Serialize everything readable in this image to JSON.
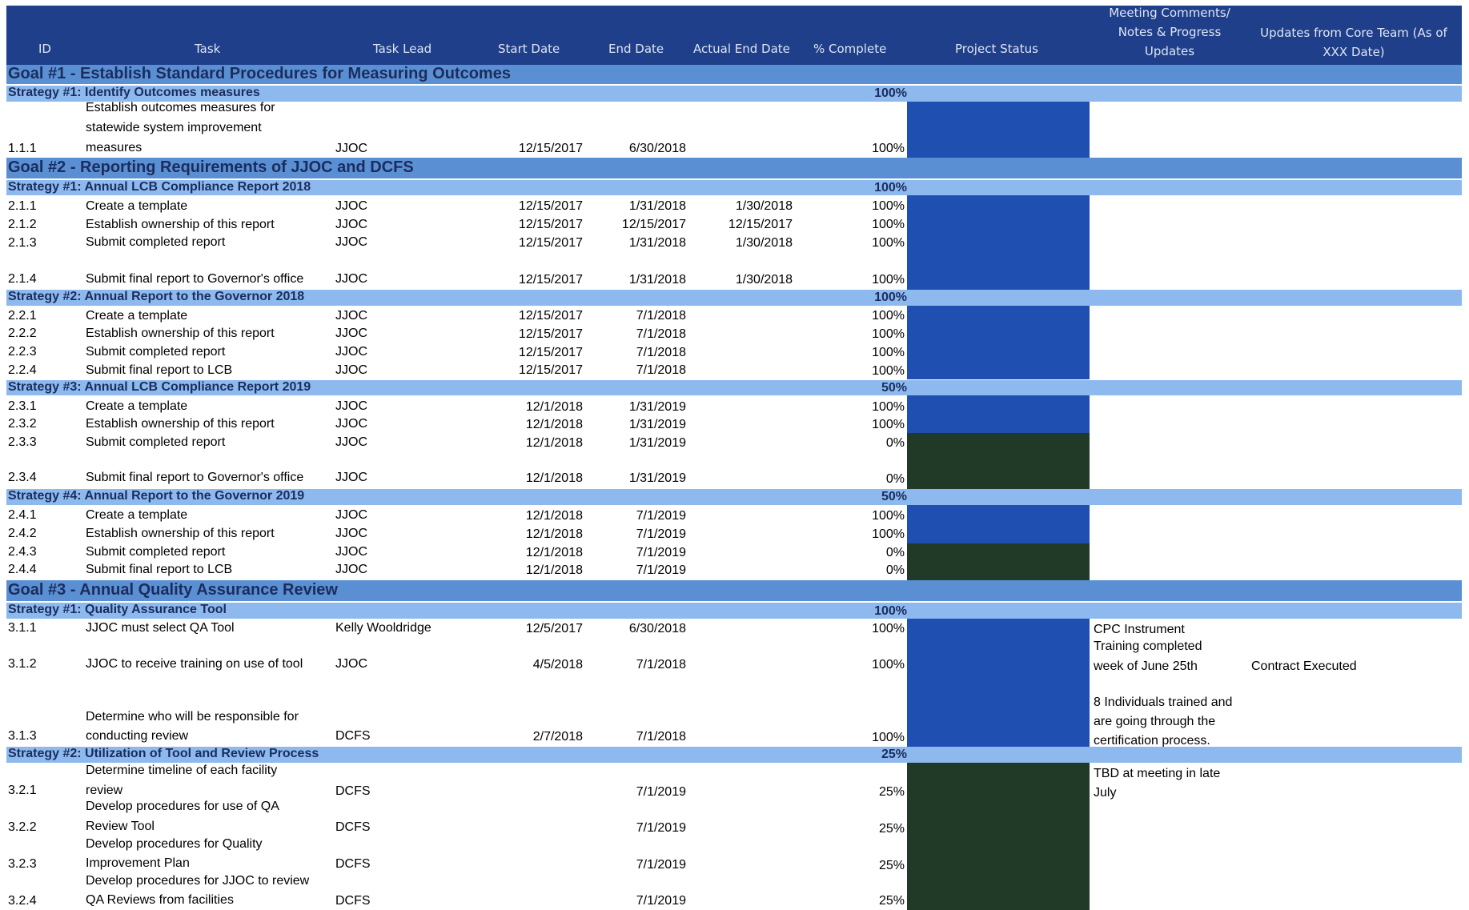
{
  "headers": {
    "id": "ID",
    "task": "Task",
    "lead": "Task Lead",
    "start": "Start Date",
    "end": "End Date",
    "actual_end": "Actual End Date",
    "pct": "% Complete",
    "status": "Project Status",
    "meeting_1": "Meeting Comments/",
    "meeting_2": "Notes & Progress",
    "meeting_3": "Updates",
    "core_1": "Updates from Core Team (As of",
    "core_2": "XXX Date)"
  },
  "colors": {
    "header": "#1f3f8a",
    "goal": "#5b8fd4",
    "strategy": "#8db9ef",
    "status_blue": "#1f4fb0",
    "status_green": "#213a27"
  },
  "goal1": {
    "title": "Goal #1 - Establish Standard Procedures for Measuring Outcomes"
  },
  "g1s1": {
    "title": "Strategy #1: Identify Outcomes measures",
    "pct": "100%"
  },
  "t111": {
    "id": "1.1.1",
    "task_1": "Establish outcomes measures for",
    "task_2": "statewide system improvement",
    "task_3": "measures",
    "lead": "JJOC",
    "start": "12/15/2017",
    "end": "6/30/2018",
    "actual": "",
    "pct": "100%"
  },
  "goal2": {
    "title": "Goal #2 - Reporting Requirements of JJOC and DCFS"
  },
  "g2s1": {
    "title": "Strategy #1: Annual LCB Compliance Report 2018",
    "pct": "100%"
  },
  "t211": {
    "id": "2.1.1",
    "task": "Create a template",
    "lead": "JJOC",
    "start": "12/15/2017",
    "end": "1/31/2018",
    "actual": "1/30/2018",
    "pct": "100%"
  },
  "t212": {
    "id": "2.1.2",
    "task": "Establish ownership of this report",
    "lead": "JJOC",
    "start": "12/15/2017",
    "end": "12/15/2017",
    "actual": "12/15/2017",
    "pct": "100%"
  },
  "t213": {
    "id": "2.1.3",
    "task": "Submit completed report",
    "lead": "JJOC",
    "start": "12/15/2017",
    "end": "1/31/2018",
    "actual": "1/30/2018",
    "pct": "100%"
  },
  "t214": {
    "id": "2.1.4",
    "task": "Submit final report to Governor's office",
    "lead": "JJOC",
    "start": "12/15/2017",
    "end": "1/31/2018",
    "actual": "1/30/2018",
    "pct": "100%"
  },
  "g2s2": {
    "title": "Strategy #2: Annual Report to the Governor 2018",
    "pct": "100%"
  },
  "t221": {
    "id": "2.2.1",
    "task": "Create a template",
    "lead": "JJOC",
    "start": "12/15/2017",
    "end": "7/1/2018",
    "pct": "100%"
  },
  "t222": {
    "id": "2.2.2",
    "task": "Establish ownership of this report",
    "lead": "JJOC",
    "start": "12/15/2017",
    "end": "7/1/2018",
    "pct": "100%"
  },
  "t223": {
    "id": "2.2.3",
    "task": "Submit completed report",
    "lead": "JJOC",
    "start": "12/15/2017",
    "end": "7/1/2018",
    "pct": "100%"
  },
  "t224": {
    "id": "2.2.4",
    "task": "Submit final report to LCB",
    "lead": "JJOC",
    "start": "12/15/2017",
    "end": "7/1/2018",
    "pct": "100%"
  },
  "g2s3": {
    "title": "Strategy #3: Annual LCB Compliance Report 2019",
    "pct": "50%"
  },
  "t231": {
    "id": "2.3.1",
    "task": "Create a template",
    "lead": "JJOC",
    "start": "12/1/2018",
    "end": "1/31/2019",
    "pct": "100%"
  },
  "t232": {
    "id": "2.3.2",
    "task": "Establish ownership of this report",
    "lead": "JJOC",
    "start": "12/1/2018",
    "end": "1/31/2019",
    "pct": "100%"
  },
  "t233": {
    "id": "2.3.3",
    "task": "Submit completed report",
    "lead": "JJOC",
    "start": "12/1/2018",
    "end": "1/31/2019",
    "pct": "0%"
  },
  "t234": {
    "id": "2.3.4",
    "task": "Submit final report to Governor's office",
    "lead": "JJOC",
    "start": "12/1/2018",
    "end": "1/31/2019",
    "pct": "0%"
  },
  "g2s4": {
    "title": "Strategy #4: Annual Report to the Governor 2019",
    "pct": "50%"
  },
  "t241": {
    "id": "2.4.1",
    "task": "Create a template",
    "lead": "JJOC",
    "start": "12/1/2018",
    "end": "7/1/2019",
    "pct": "100%"
  },
  "t242": {
    "id": "2.4.2",
    "task": "Establish ownership of this report",
    "lead": "JJOC",
    "start": "12/1/2018",
    "end": "7/1/2019",
    "pct": "100%"
  },
  "t243": {
    "id": "2.4.3",
    "task": "Submit completed report",
    "lead": "JJOC",
    "start": "12/1/2018",
    "end": "7/1/2019",
    "pct": "0%"
  },
  "t244": {
    "id": "2.4.4",
    "task": "Submit final report to LCB",
    "lead": "JJOC",
    "start": "12/1/2018",
    "end": "7/1/2019",
    "pct": "0%"
  },
  "goal3": {
    "title": "Goal #3 - Annual Quality Assurance Review"
  },
  "g3s1": {
    "title": "Strategy #1: Quality Assurance Tool",
    "pct": "100%"
  },
  "t311": {
    "id": "3.1.1",
    "task": "JJOC must select QA Tool",
    "lead": "Kelly Wooldridge",
    "start": "12/5/2017",
    "end": "6/30/2018",
    "pct": "100%"
  },
  "t312": {
    "id": "3.1.2",
    "task": "JJOC to receive training on use of tool",
    "lead": "JJOC",
    "start": "4/5/2018",
    "end": "7/1/2018",
    "pct": "100%"
  },
  "t313": {
    "id": "3.1.3",
    "task_1": "Determine who will be responsible for",
    "task_2": "conducting review",
    "lead": "DCFS",
    "start": "2/7/2018",
    "end": "7/1/2018",
    "pct": "100%"
  },
  "notes31": {
    "n1": "CPC Instrument",
    "n2": "Training completed",
    "n3": "week of June 25th",
    "core": "Contract Executed",
    "n4": "8 Individuals trained and",
    "n5": "are going through the",
    "n6": "certification process."
  },
  "g3s2": {
    "title": "Strategy #2: Utilization of Tool and Review Process",
    "pct": "25%"
  },
  "t321": {
    "id": "3.2.1",
    "task_1": "Determine timeline of each facility",
    "task_2": "review",
    "lead": "DCFS",
    "end": "7/1/2019",
    "pct": "25%"
  },
  "t322": {
    "id": "3.2.2",
    "task_1": "Develop procedures for use of QA",
    "task_2": "Review Tool",
    "lead": "DCFS",
    "end": "7/1/2019",
    "pct": "25%"
  },
  "t323": {
    "id": "3.2.3",
    "task_1": "Develop procedures for Quality",
    "task_2": "Improvement Plan",
    "lead": "DCFS",
    "end": "7/1/2019",
    "pct": "25%"
  },
  "t324": {
    "id": "3.2.4",
    "task_1": "Develop procedures for JJOC to review",
    "task_2": "QA Reviews from facilities",
    "lead": "DCFS",
    "end": "7/1/2019",
    "pct": "25%"
  },
  "notes32": {
    "n1": "TBD at meeting in late",
    "n2": "July"
  }
}
